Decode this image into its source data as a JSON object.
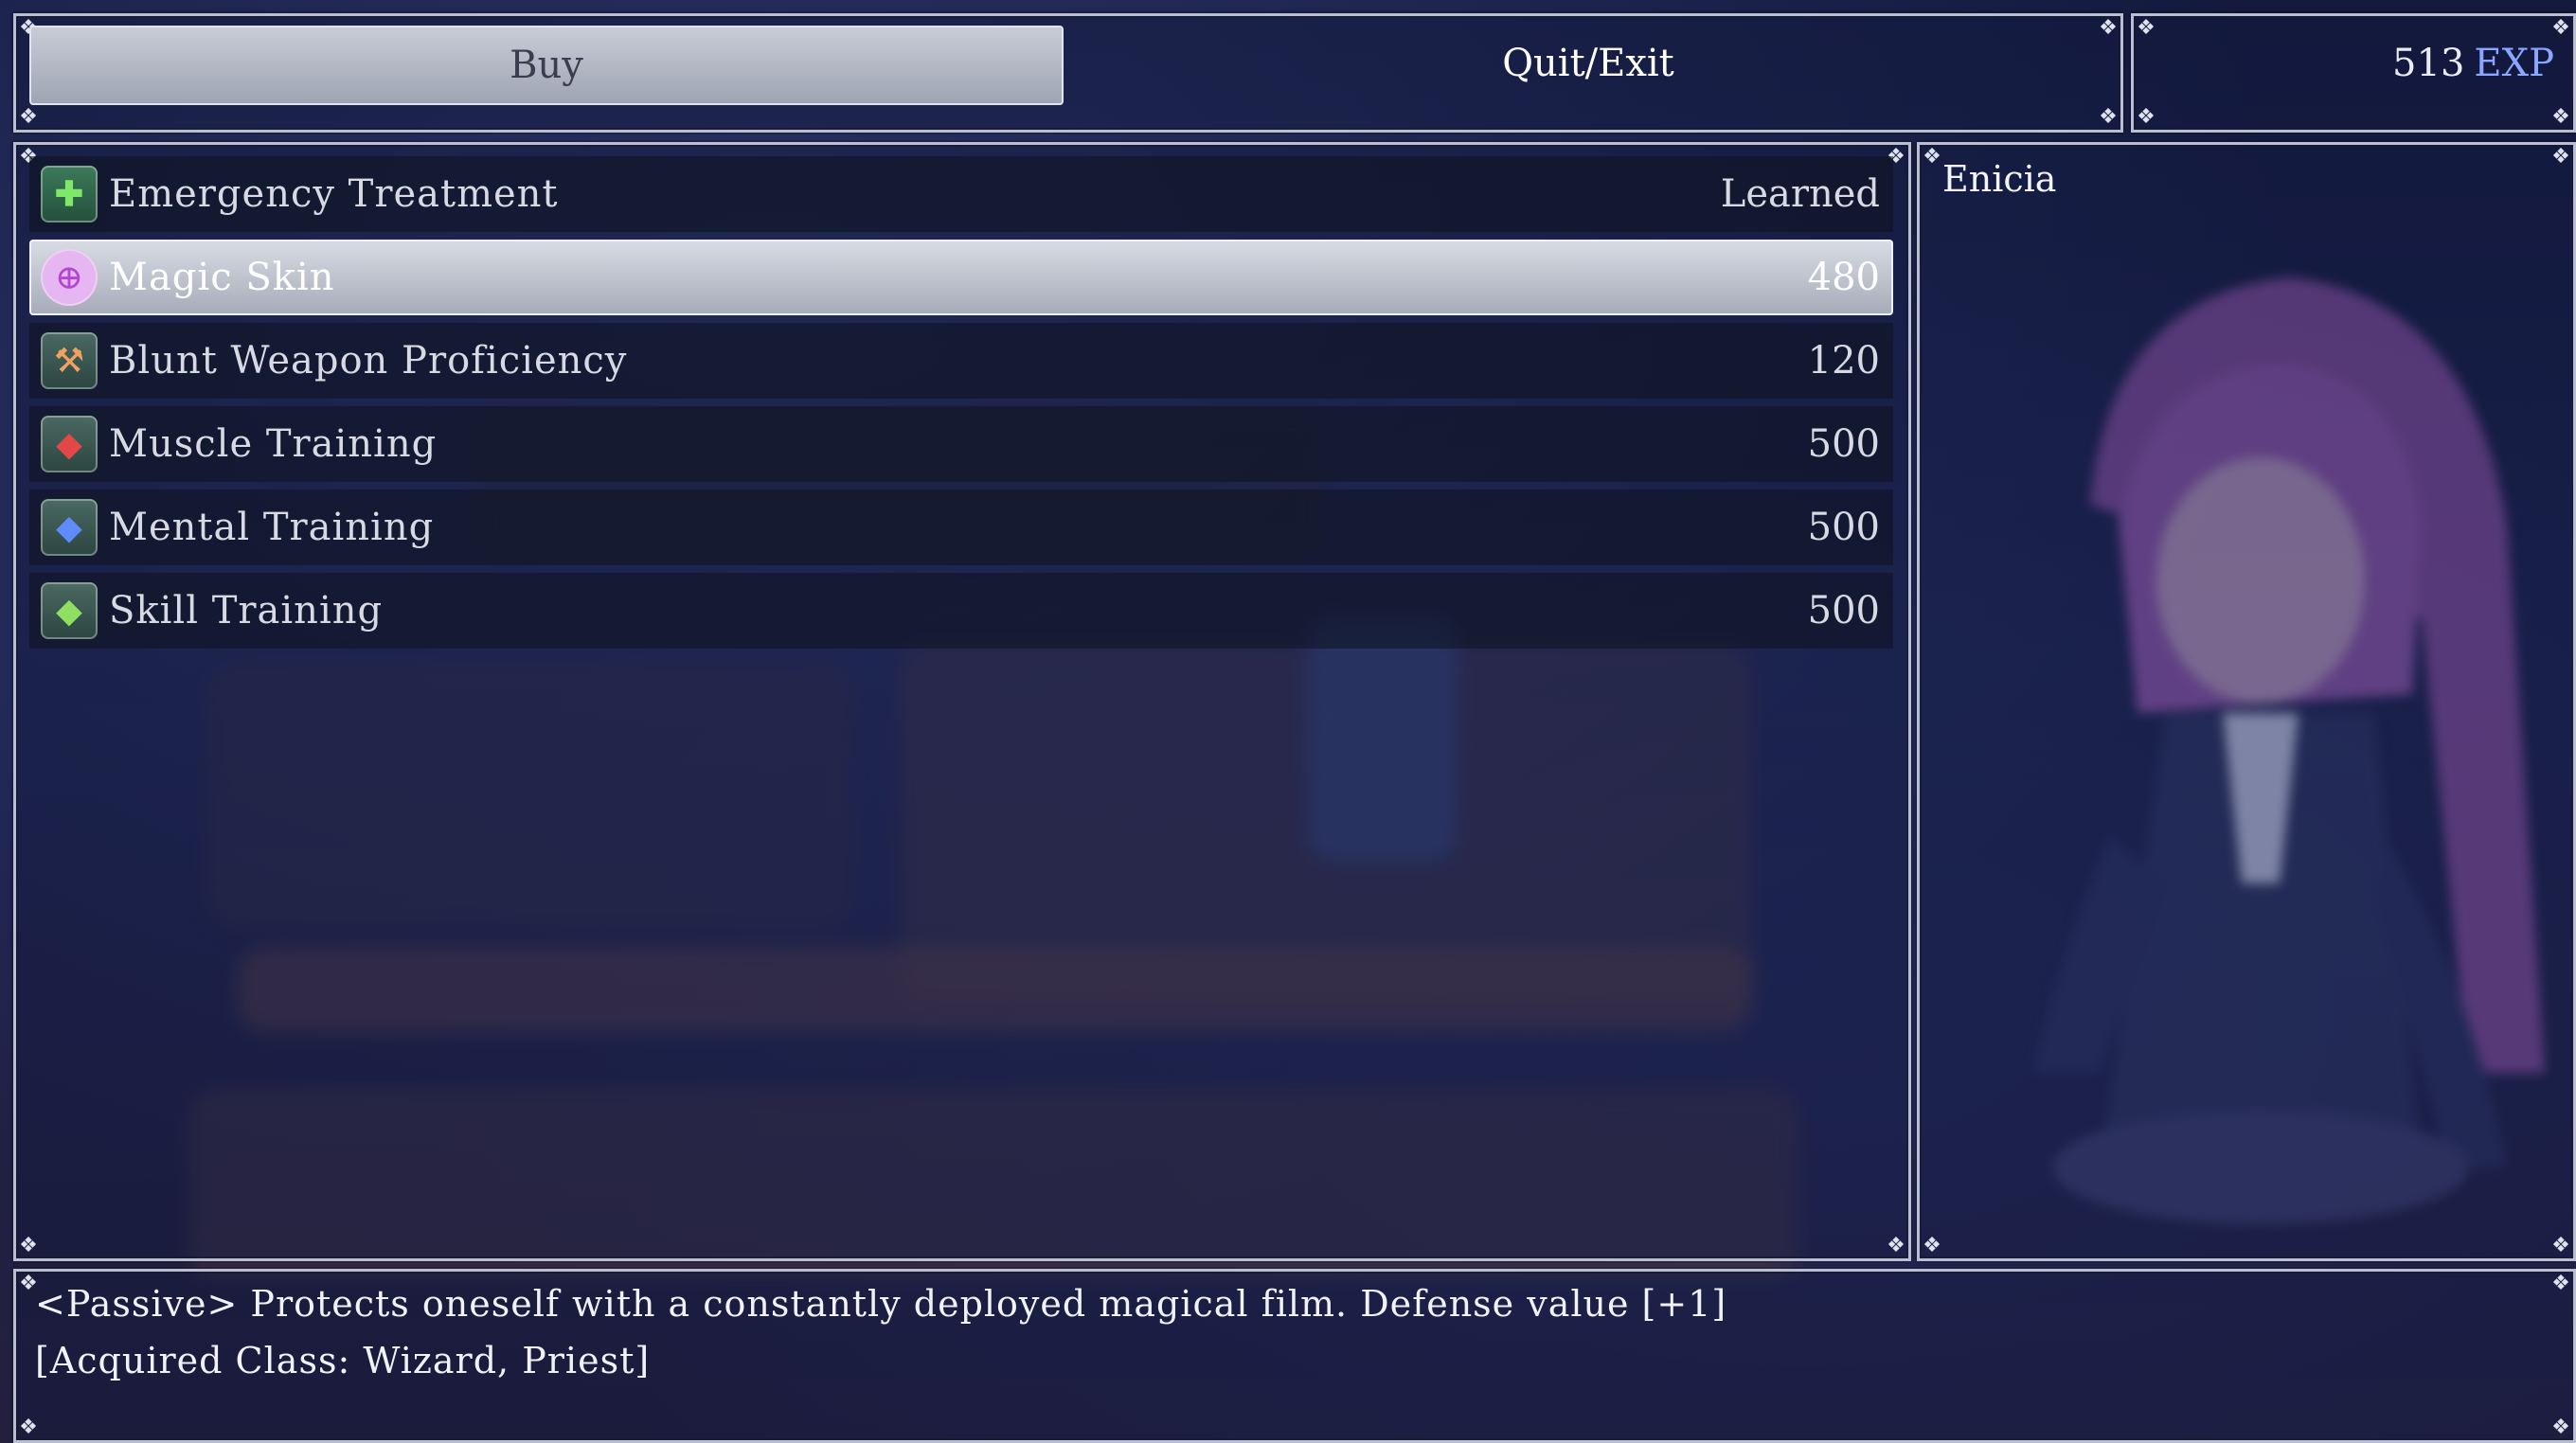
{
  "commands": {
    "buy_label": "Buy",
    "quit_label": "Quit/Exit"
  },
  "currency": {
    "amount": "513",
    "unit": "EXP"
  },
  "skills": [
    {
      "name": "Emergency Treatment",
      "price": "Learned",
      "icon": "green-plus-icon"
    },
    {
      "name": "Magic Skin",
      "price": "480",
      "icon": "magic-skin-icon"
    },
    {
      "name": "Blunt Weapon Proficiency",
      "price": "120",
      "icon": "blunt-weapon-icon"
    },
    {
      "name": "Muscle Training",
      "price": "500",
      "icon": "red-crystal-icon"
    },
    {
      "name": "Mental Training",
      "price": "500",
      "icon": "blue-crystal-icon"
    },
    {
      "name": "Skill Training",
      "price": "500",
      "icon": "green-crystal-icon"
    }
  ],
  "selected_index": 1,
  "character": {
    "name": "Enicia"
  },
  "help": {
    "line1": "<Passive> Protects oneself with a constantly deployed magical film. Defense value [+1]",
    "line2": "[Acquired Class: Wizard, Priest]"
  }
}
